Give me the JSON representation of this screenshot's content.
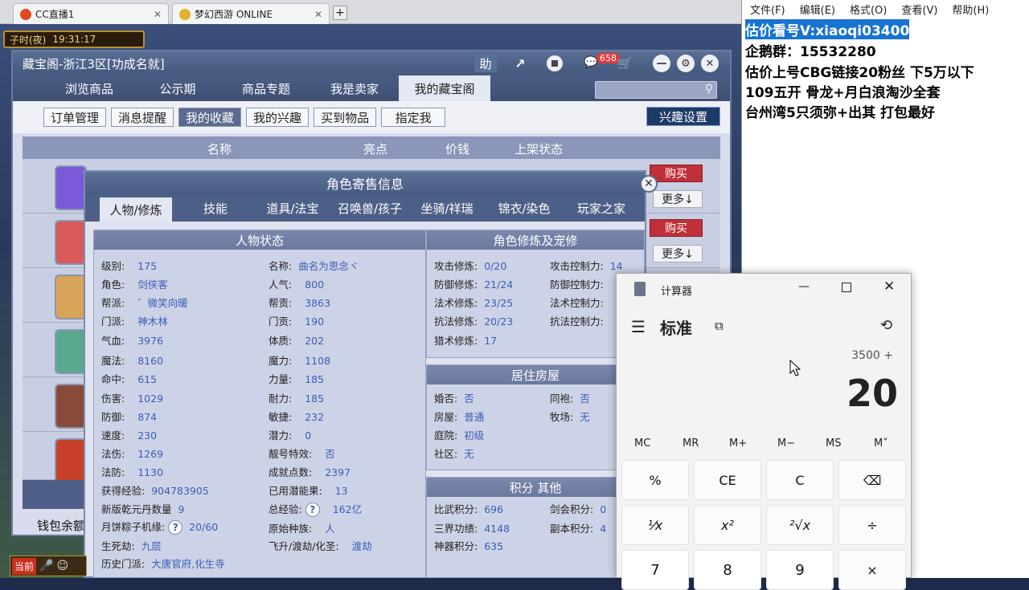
{
  "browser_tabs": [
    {
      "label": "CC直播1",
      "close": "✕"
    },
    {
      "label": "梦幻西游 ONLINE",
      "close": "✕"
    }
  ],
  "new_tab": "+",
  "game": {
    "time_label": "子时(夜)",
    "clock": "19:31:17",
    "treasure_window": {
      "title": "藏宝阁-浙江3区[功成名就]",
      "help_label": "助",
      "badge_count": "658",
      "nav_tabs": [
        "浏览商品",
        "公示期",
        "商品专题",
        "我是卖家",
        "我的藏宝阁"
      ],
      "sub_tabs": [
        "订单管理",
        "消息提醒",
        "我的收藏",
        "我的兴趣",
        "买到物品",
        "指定我"
      ],
      "interest_settings": "兴趣设置",
      "columns": [
        "名称",
        "亮点",
        "价钱",
        "上架状态"
      ],
      "buy_label": "购买",
      "more_label": "更多↓",
      "wallet_label": "钱包余额"
    },
    "sale_dialog": {
      "title": "角色寄售信息",
      "tabs": [
        "人物/修炼",
        "技能",
        "道具/法宝",
        "召唤兽/孩子",
        "坐骑/祥瑞",
        "锦衣/染色",
        "玩家之家"
      ],
      "status_title": "人物状态",
      "status_left": [
        {
          "k": "级别:",
          "v": "175"
        },
        {
          "k": "角色:",
          "v": "剑侠客"
        },
        {
          "k": "帮派:",
          "v": "゛微笑向暖"
        },
        {
          "k": "门派:",
          "v": "神木林"
        },
        {
          "k": "气血:",
          "v": "3976"
        },
        {
          "k": "魔法:",
          "v": "8160"
        },
        {
          "k": "命中:",
          "v": "615"
        },
        {
          "k": "伤害:",
          "v": "1029"
        },
        {
          "k": "防御:",
          "v": "874"
        },
        {
          "k": "速度:",
          "v": "230"
        },
        {
          "k": "法伤:",
          "v": "1269"
        },
        {
          "k": "法防:",
          "v": "1130"
        },
        {
          "k": "获得经验:",
          "v": "904783905"
        },
        {
          "k": "新版乾元丹数量",
          "v": "9"
        },
        {
          "k": "月饼粽子机缘:",
          "v": "20/60"
        },
        {
          "k": "生死劫:",
          "v": "九层"
        },
        {
          "k": "历史门派:",
          "v": "大唐官府,化生寺"
        }
      ],
      "status_right": [
        {
          "k": "名称:",
          "v": "曲名为思念ヾ"
        },
        {
          "k": "人气:",
          "v": "800"
        },
        {
          "k": "帮贡:",
          "v": "3863"
        },
        {
          "k": "门贡:",
          "v": "190"
        },
        {
          "k": "体质:",
          "v": "202"
        },
        {
          "k": "魔力:",
          "v": "1108"
        },
        {
          "k": "力量:",
          "v": "185"
        },
        {
          "k": "耐力:",
          "v": "185"
        },
        {
          "k": "敏捷:",
          "v": "232"
        },
        {
          "k": "潜力:",
          "v": "0"
        },
        {
          "k": "靓号特效:",
          "v": "否"
        },
        {
          "k": "成就点数:",
          "v": "2397"
        },
        {
          "k": "已用潜能果:",
          "v": "13"
        },
        {
          "k": "总经验:",
          "v": "162亿"
        },
        {
          "k": "原始种族:",
          "v": "人"
        },
        {
          "k": "飞升/渡劫/化圣:",
          "v": "渡劫"
        }
      ],
      "cultivation_title": "角色修炼及宠修",
      "cultivation_left": [
        {
          "k": "攻击修炼:",
          "v": "0/20"
        },
        {
          "k": "防御修炼:",
          "v": "21/24"
        },
        {
          "k": "法术修炼:",
          "v": "23/25"
        },
        {
          "k": "抗法修炼:",
          "v": "20/23"
        },
        {
          "k": "猎术修炼:",
          "v": "17"
        }
      ],
      "cultivation_right": [
        {
          "k": "攻击控制力:",
          "v": "14"
        },
        {
          "k": "防御控制力:",
          "v": ""
        },
        {
          "k": "法术控制力:",
          "v": ""
        },
        {
          "k": "抗法控制力:",
          "v": ""
        }
      ],
      "housing_title": "居住房屋",
      "housing_left": [
        {
          "k": "婚否:",
          "v": "否"
        },
        {
          "k": "房屋:",
          "v": "普通"
        },
        {
          "k": "庭院:",
          "v": "初级"
        },
        {
          "k": "社区:",
          "v": "无"
        }
      ],
      "housing_right": [
        {
          "k": "同袍:",
          "v": "否"
        },
        {
          "k": "牧场:",
          "v": "无"
        }
      ],
      "points_title": "积分 其他",
      "points_left": [
        {
          "k": "比武积分:",
          "v": "696"
        },
        {
          "k": "三界功绩:",
          "v": "4148"
        },
        {
          "k": "神器积分:",
          "v": "635"
        }
      ],
      "points_right": [
        {
          "k": "剑会积分:",
          "v": "0"
        },
        {
          "k": "副本积分:",
          "v": "4"
        }
      ]
    },
    "bottom_bar_label": "当前"
  },
  "notepad": {
    "menu": [
      "文件(F)",
      "编辑(E)",
      "格式(O)",
      "查看(V)",
      "帮助(H)"
    ],
    "lines": [
      "估价看号V:xiaoqi03400",
      "企鹅群：15532280",
      "估价上号CBG链接20粉丝 下5万以下",
      "109五开 骨龙+月白浪淘沙全套",
      "台州湾5只须弥+出其 打包最好"
    ]
  },
  "calculator": {
    "title": "计算器",
    "mode": "标准",
    "expression": "3500 +",
    "display": "20",
    "memory": [
      "MC",
      "MR",
      "M+",
      "M−",
      "MS",
      "M˅"
    ],
    "row1": [
      "%",
      "CE",
      "C",
      "⌫"
    ],
    "row2": [
      "¹⁄x",
      "x²",
      "²√x",
      "÷"
    ],
    "row3": [
      "7",
      "8",
      "9",
      "×"
    ]
  }
}
